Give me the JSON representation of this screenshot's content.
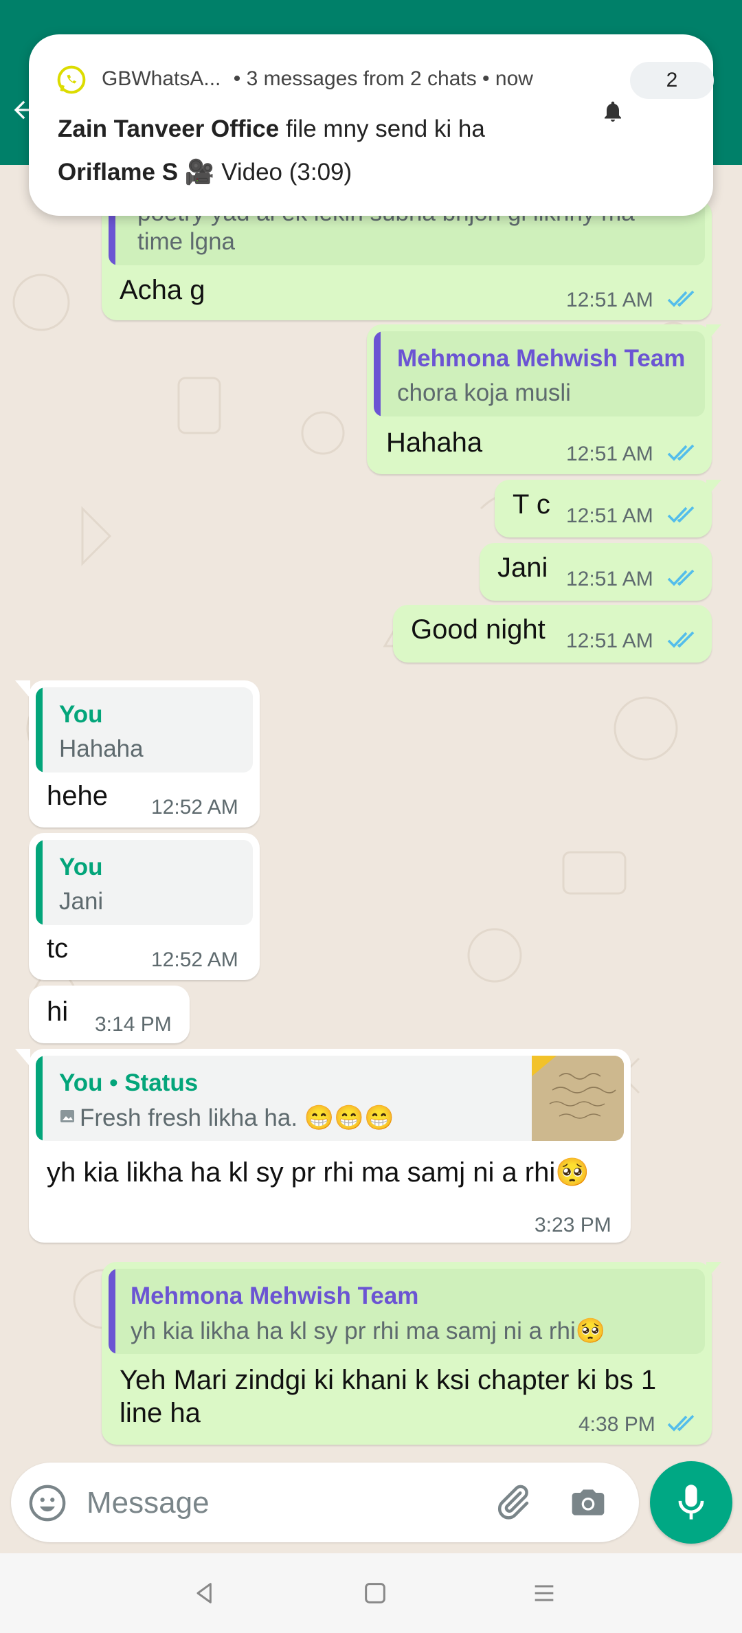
{
  "notification": {
    "app_name": "GBWhatsA...",
    "summary": "• 3 messages from 2 chats • now",
    "count": "2",
    "lines": [
      {
        "sender": "Zain Tanveer Office",
        "text": "file mny send ki ha"
      },
      {
        "sender": "Oriflame S",
        "text": "🎥 Video (3:09)"
      }
    ]
  },
  "messages": {
    "m1": {
      "quote_text_1": "poetry yad ai ek lekin subha bhjon gi likhny ma",
      "quote_text_2": "time lgna",
      "text": "Acha g",
      "time": "12:51 AM"
    },
    "m2": {
      "quote_name": "Mehmona Mehwish Team",
      "quote_text": "chora koja musli",
      "text": "Hahaha",
      "time": "12:51 AM"
    },
    "m3": {
      "text": "T c",
      "time": "12:51 AM"
    },
    "m4": {
      "text": "Jani",
      "time": "12:51 AM"
    },
    "m5": {
      "text": "Good night",
      "time": "12:51 AM"
    },
    "m6": {
      "quote_name": "You",
      "quote_text": "Hahaha",
      "text": "hehe",
      "time": "12:52 AM"
    },
    "m7": {
      "quote_name": "You",
      "quote_text": "Jani",
      "text": "tc",
      "time": "12:52 AM"
    },
    "m8": {
      "text": "hi",
      "time": "3:14 PM"
    },
    "m9": {
      "quote_name": "You • Status",
      "quote_text": "Fresh fresh likha ha. 😁😁😁",
      "text": "yh kia likha ha kl sy pr rhi ma samj ni a rhi🥺",
      "time": "3:23 PM"
    },
    "m10": {
      "quote_name": "Mehmona Mehwish Team",
      "quote_text": "yh kia likha ha kl sy pr rhi ma samj ni a rhi🥺",
      "text_line1": "Yeh Mari zindgi ki khani k ksi chapter ki bs 1",
      "text_line2": "line ha",
      "time": "4:38 PM"
    }
  },
  "composer": {
    "placeholder": "Message"
  },
  "icons": {
    "back": "back-arrow-icon",
    "emoji": "emoji-icon",
    "attach": "paperclip-icon",
    "camera": "camera-icon",
    "mic": "microphone-icon",
    "bell": "bell-icon",
    "read_ticks": "double-tick-icon"
  },
  "colors": {
    "header": "#008069",
    "outgoing_bubble": "#dbf8c6",
    "incoming_bubble": "#ffffff",
    "read_ticks": "#53bdeb",
    "quote_purple": "#6b54d3",
    "quote_green": "#03a57a",
    "mic_button": "#00a884"
  }
}
